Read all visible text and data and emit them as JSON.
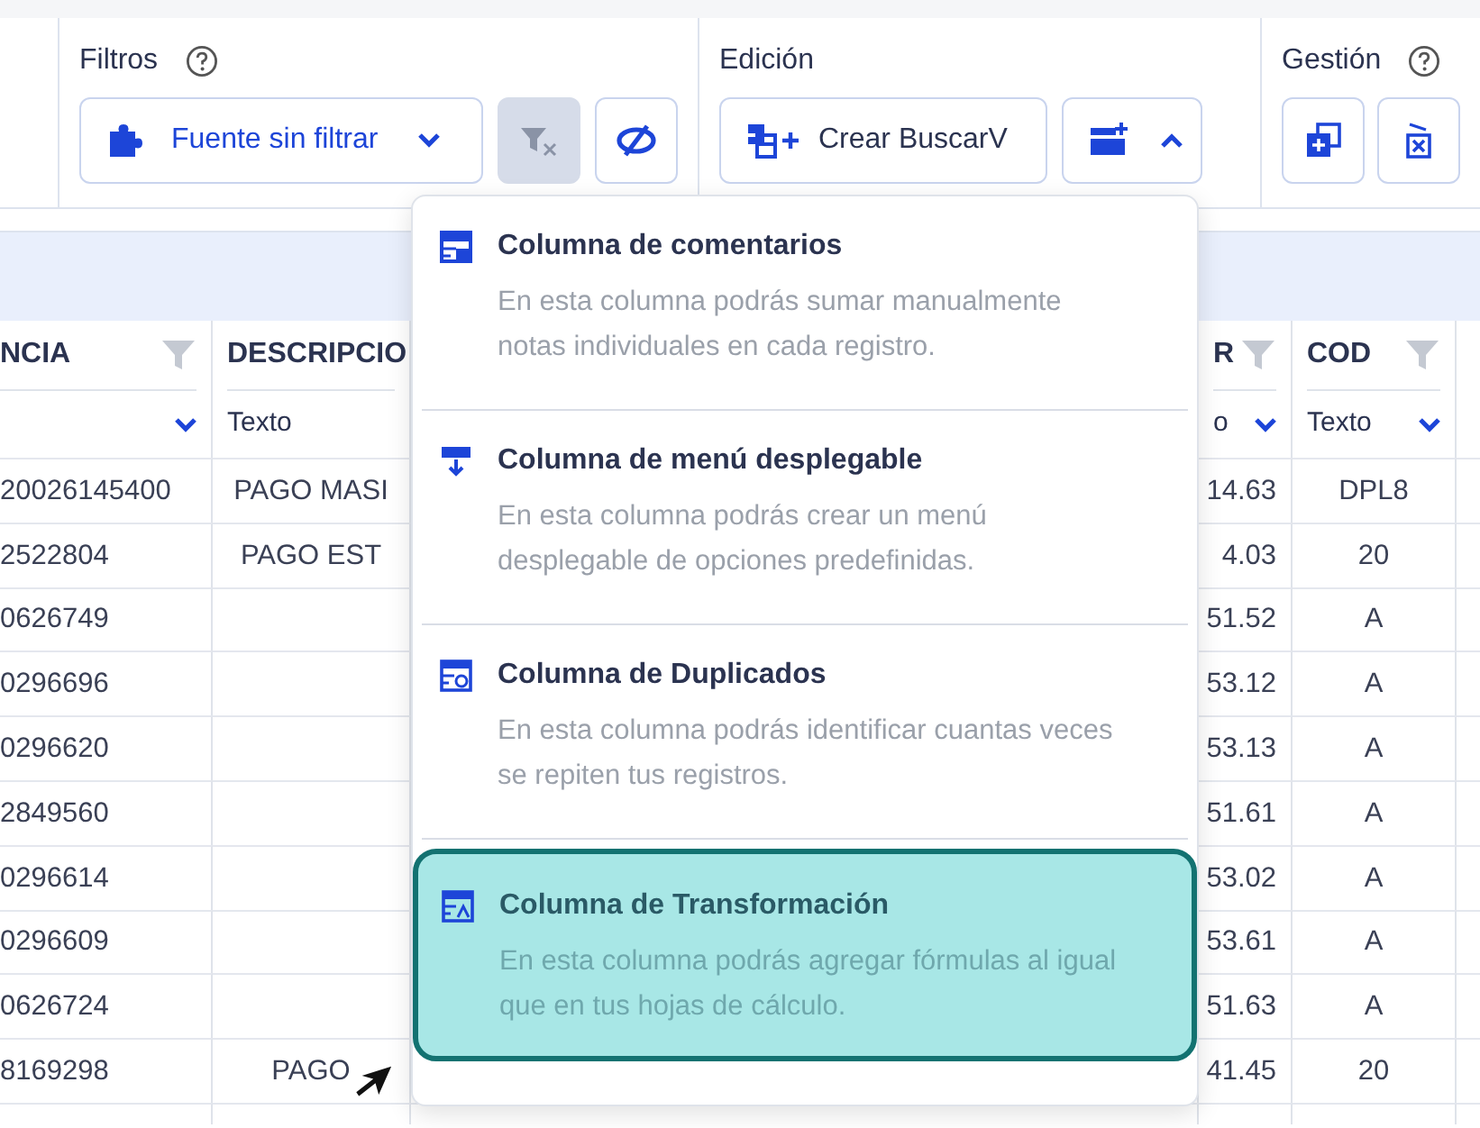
{
  "toolbar": {
    "groups": [
      {
        "kind": "filters",
        "title": "Filtros",
        "help": true,
        "source_button": "Fuente sin filtrar",
        "clear_filter_disabled": true
      },
      {
        "kind": "edition",
        "title": "Edición",
        "help": false,
        "vlookup_button": "Crear BuscarV",
        "add_column_expanded": true
      },
      {
        "kind": "management",
        "title": "Gestión",
        "help": true
      }
    ]
  },
  "table": {
    "columns": [
      {
        "header": "NCIA",
        "filter": true,
        "type_menu": true
      },
      {
        "header": "DESCRIPCIO",
        "type": "Texto",
        "filter": false,
        "type_menu": false
      },
      {
        "header": "R",
        "type": "o",
        "filter": true,
        "type_menu": true
      },
      {
        "header": "COD",
        "type": "Texto",
        "filter": true,
        "type_menu": true
      }
    ],
    "rows": [
      [
        "20026145400",
        "PAGO MASI",
        "14.63",
        "DPL8"
      ],
      [
        "2522804",
        "PAGO EST",
        "4.03",
        "20"
      ],
      [
        "0626749",
        null,
        "51.52",
        "A"
      ],
      [
        "0296696",
        null,
        "53.12",
        "A"
      ],
      [
        "0296620",
        null,
        "53.13",
        "A"
      ],
      [
        "2849560",
        null,
        "51.61",
        "A"
      ],
      [
        "0296614",
        null,
        "53.02",
        "A"
      ],
      [
        "0296609",
        null,
        "53.61",
        "A"
      ],
      [
        "0626724",
        null,
        "51.63",
        "A"
      ],
      [
        "8169298",
        "PAGO",
        "41.45",
        "20"
      ]
    ]
  },
  "column_menu": {
    "items": [
      {
        "title": "Columna de comentarios",
        "description": "En esta columna podrás sumar manualmente notas individuales en cada registro.",
        "selected": false
      },
      {
        "title": "Columna de menú desplegable",
        "description": "En esta columna podrás crear un menú desplegable de opciones predefinidas.",
        "selected": false
      },
      {
        "title": "Columna de Duplicados",
        "description": "En esta columna podrás identificar cuantas veces se repiten tus registros.",
        "selected": false
      },
      {
        "title": "Columna de Transformación",
        "description": "En esta columna podrás agregar fórmulas al igual que en tus hojas de cálculo.",
        "selected": true
      }
    ]
  }
}
